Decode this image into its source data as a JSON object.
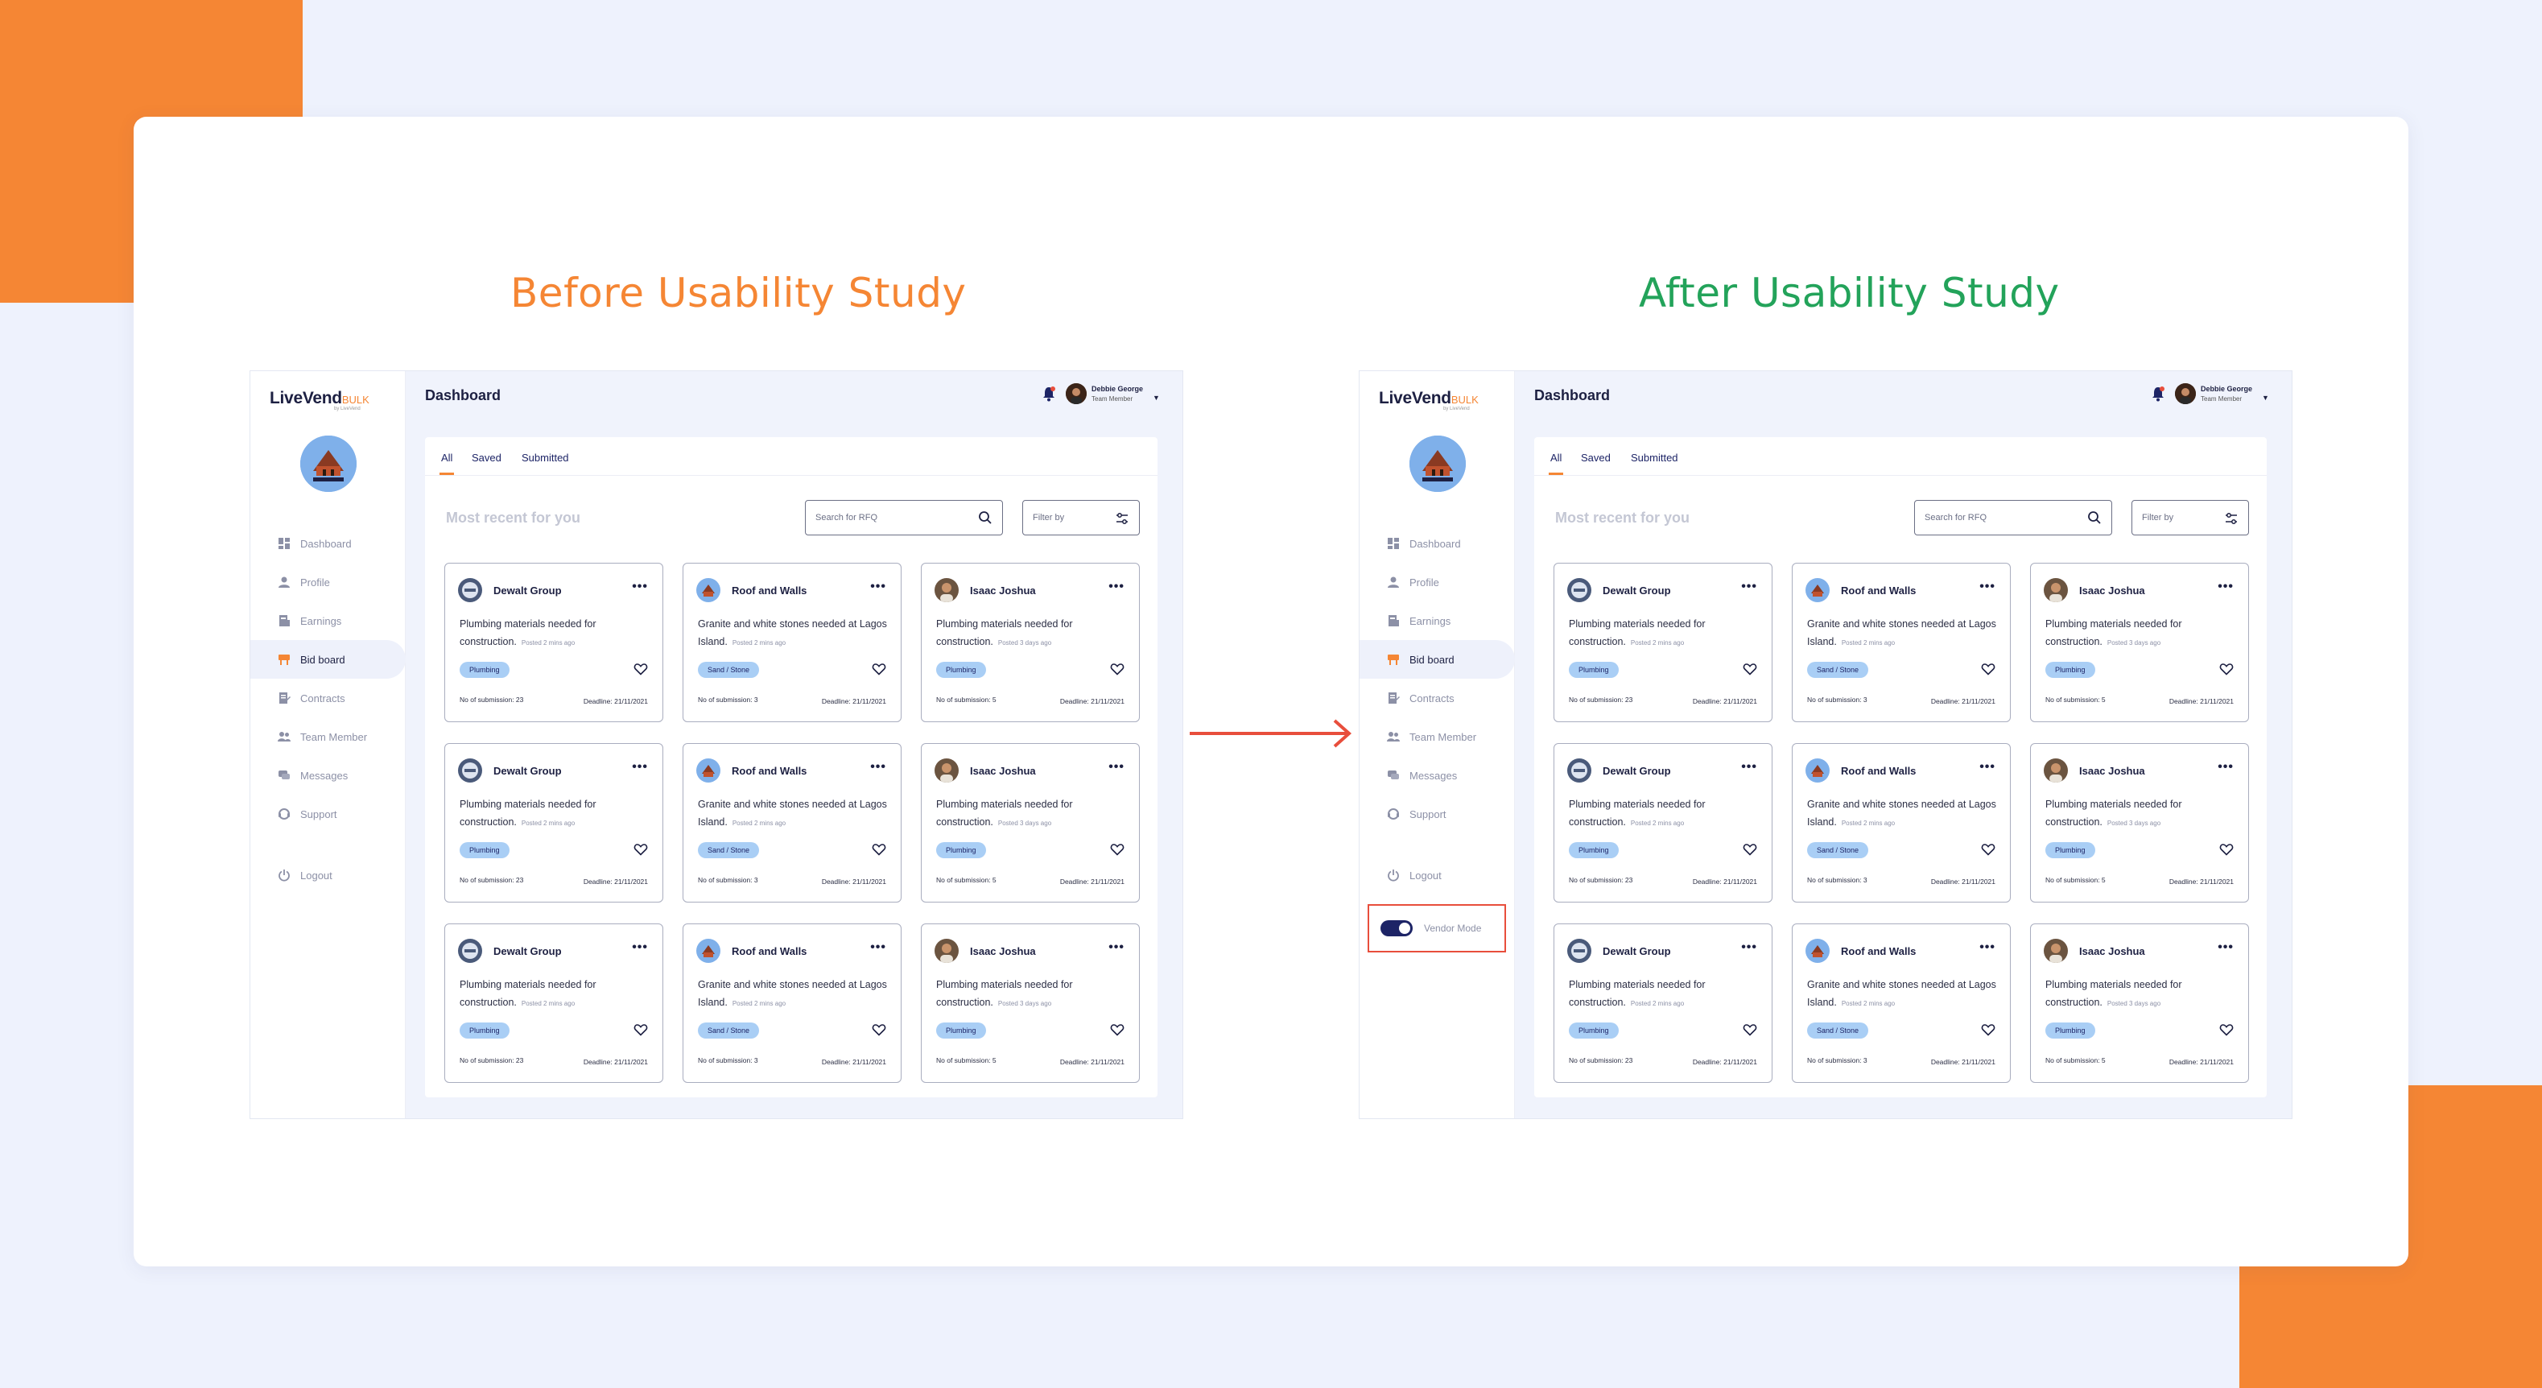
{
  "headings": {
    "before": "Before Usability Study",
    "after": "After Usability  Study"
  },
  "colors": {
    "accent_orange": "#f58634",
    "after_green": "#23a35a",
    "navy": "#1d2042",
    "tag_blue": "#a9cef5",
    "highlight_red": "#e84e3c",
    "page_bg": "#eef2fd"
  },
  "app": {
    "logo_main": "LiveVend",
    "logo_suffix": "BULK",
    "logo_byline": "by LiveVend",
    "page_title": "Dashboard",
    "user": {
      "name": "Debbie George",
      "role": "Team Member"
    },
    "tabs": [
      "All",
      "Saved",
      "Submitted"
    ],
    "section_title": "Most recent for you",
    "search_placeholder": "Search for RFQ",
    "filter_label": "Filter by",
    "nav": [
      {
        "label": "Dashboard",
        "icon": "dashboard-icon"
      },
      {
        "label": "Profile",
        "icon": "profile-icon"
      },
      {
        "label": "Earnings",
        "icon": "earnings-icon"
      },
      {
        "label": "Bid board",
        "icon": "bid-board-icon",
        "active": true
      },
      {
        "label": "Contracts",
        "icon": "contracts-icon"
      },
      {
        "label": "Team Member",
        "icon": "team-icon"
      },
      {
        "label": "Messages",
        "icon": "messages-icon"
      },
      {
        "label": "Support",
        "icon": "support-icon"
      }
    ],
    "logout": "Logout",
    "vendor_mode": "Vendor Mode"
  },
  "cards": [
    {
      "company": "Dewalt Group",
      "desc": "Plumbing materials needed for construction.",
      "posted": "Posted 2 mins ago",
      "tag": "Plumbing",
      "subs": "No of submission: 23",
      "deadline": "Deadline: 21/11/2021",
      "avatar": "dewalt"
    },
    {
      "company": "Roof and Walls",
      "desc": "Granite and white stones needed at Lagos Island.",
      "posted": "Posted 2 mins ago",
      "tag": "Sand / Stone",
      "subs": "No of submission: 3",
      "deadline": "Deadline: 21/11/2021",
      "avatar": "roof"
    },
    {
      "company": "Isaac Joshua",
      "desc": "Plumbing materials needed for construction.",
      "posted": "Posted 3 days ago",
      "tag": "Plumbing",
      "subs": "No of submission: 5",
      "deadline": "Deadline: 21/11/2021",
      "avatar": "person"
    },
    {
      "company": "Dewalt Group",
      "desc": "Plumbing materials needed for construction.",
      "posted": "Posted 2 mins ago",
      "tag": "Plumbing",
      "subs": "No of submission: 23",
      "deadline": "Deadline: 21/11/2021",
      "avatar": "dewalt"
    },
    {
      "company": "Roof and Walls",
      "desc": "Granite and white stones needed at Lagos Island.",
      "posted": "Posted 2 mins ago",
      "tag": "Sand / Stone",
      "subs": "No of submission: 3",
      "deadline": "Deadline: 21/11/2021",
      "avatar": "roof"
    },
    {
      "company": "Isaac Joshua",
      "desc": "Plumbing materials needed for construction.",
      "posted": "Posted 3 days ago",
      "tag": "Plumbing",
      "subs": "No of submission: 5",
      "deadline": "Deadline: 21/11/2021",
      "avatar": "person"
    },
    {
      "company": "Dewalt Group",
      "desc": "Plumbing materials needed for construction.",
      "posted": "Posted 2 mins ago",
      "tag": "Plumbing",
      "subs": "No of submission: 23",
      "deadline": "Deadline: 21/11/2021",
      "avatar": "dewalt"
    },
    {
      "company": "Roof and Walls",
      "desc": "Granite and white stones needed at Lagos Island.",
      "posted": "Posted 2 mins ago",
      "tag": "Sand / Stone",
      "subs": "No of submission: 3",
      "deadline": "Deadline: 21/11/2021",
      "avatar": "roof"
    },
    {
      "company": "Isaac Joshua",
      "desc": "Plumbing materials needed for construction.",
      "posted": "Posted 3 days ago",
      "tag": "Plumbing",
      "subs": "No of submission: 5",
      "deadline": "Deadline: 21/11/2021",
      "avatar": "person"
    }
  ]
}
